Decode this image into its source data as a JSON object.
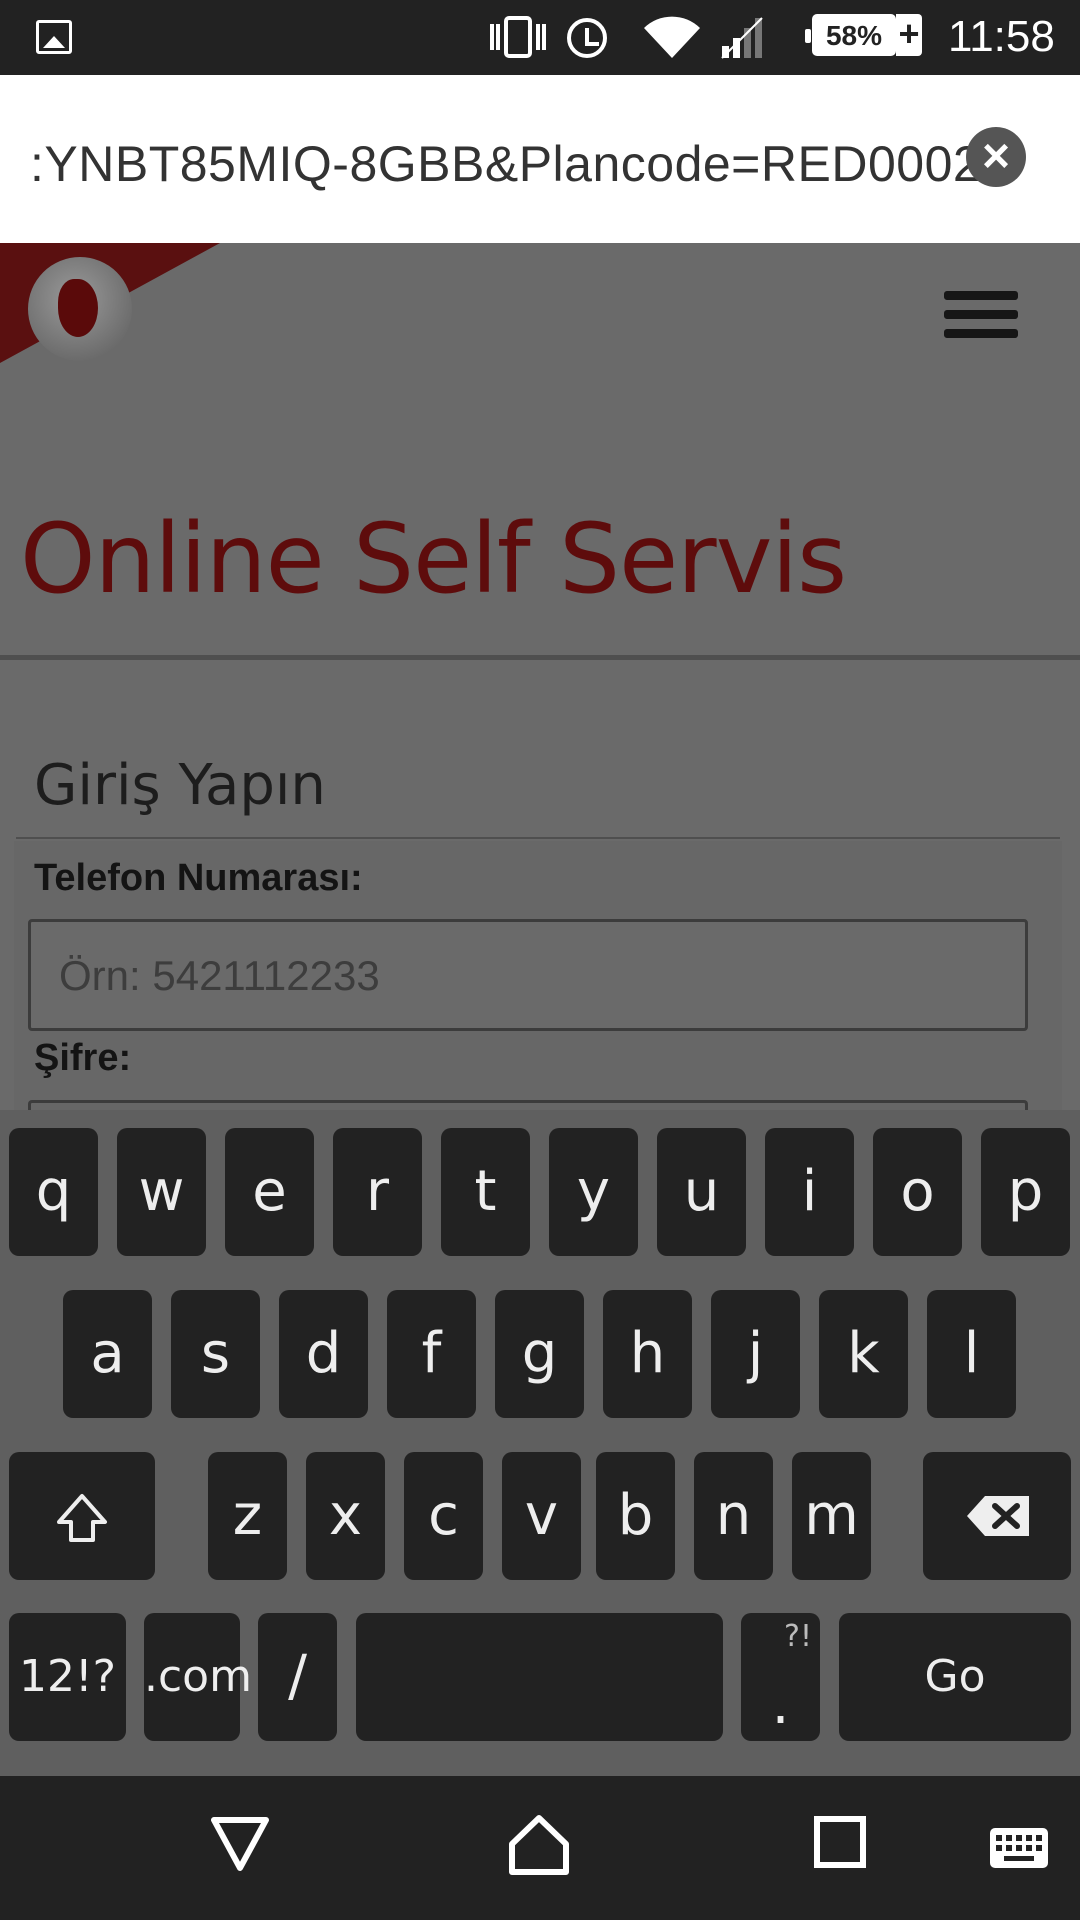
{
  "status_bar": {
    "battery": "58%",
    "battery_plus": "+",
    "time": "11:58",
    "icons": [
      "gallery-icon",
      "vibrate-icon",
      "alarm-icon",
      "wifi-icon",
      "signal-icon",
      "battery-icon"
    ]
  },
  "url_bar": {
    "url": ":YNBT85MIQ-8GBB&Plancode=RED0002",
    "clear_icon": "×"
  },
  "page": {
    "title": "Online Self Servis",
    "section_title": "Giriş Yapın",
    "phone_label": "Telefon Numarası:",
    "phone_placeholder": "Örn: 5421112233",
    "password_label": "Şifre:",
    "colors": {
      "title": "#5e0c0c",
      "brand": "#e60000"
    }
  },
  "keyboard": {
    "row1": [
      "q",
      "w",
      "e",
      "r",
      "t",
      "y",
      "u",
      "i",
      "o",
      "p"
    ],
    "row2": [
      "a",
      "s",
      "d",
      "f",
      "g",
      "h",
      "j",
      "k",
      "l"
    ],
    "row3": [
      "z",
      "x",
      "c",
      "v",
      "b",
      "n",
      "m"
    ],
    "symbols_key": "12!?",
    "com_key": ".com",
    "slash_key": "/",
    "period_key": ".",
    "period_hint": "?!",
    "go_key": "Go"
  }
}
